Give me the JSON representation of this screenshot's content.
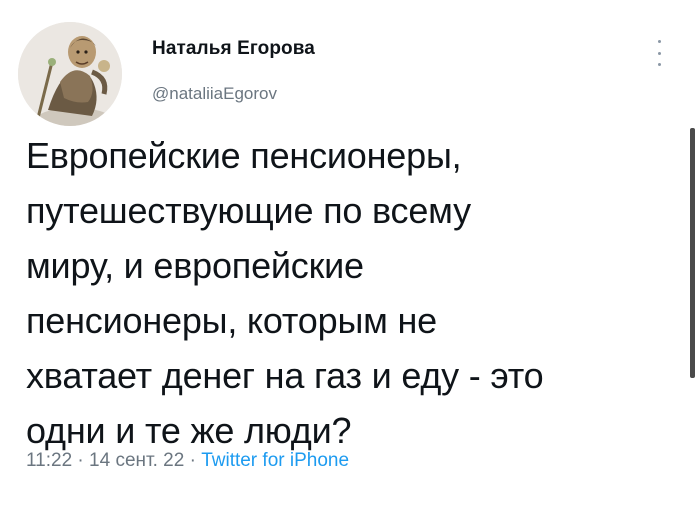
{
  "author": {
    "display_name": "Наталья Егорова",
    "handle": "@nataliiaEgorov",
    "avatar": "avatar-illustration"
  },
  "tweet": {
    "text": "Европейские пенсионеры,\nпутешествующие по всему\nмиру, и европейские\nпенсионеры, которым не\nхватает денег на газ и еду - это\nодни и те же люди?"
  },
  "meta": {
    "time": "11:22",
    "separator": " · ",
    "date": "14 сент. 22",
    "source": "Twitter for iPhone"
  },
  "icons": {
    "more": "more-vertical-icon"
  },
  "colors": {
    "text": "#0f1419",
    "secondary": "#6b7680",
    "link": "#1d9bf0"
  }
}
